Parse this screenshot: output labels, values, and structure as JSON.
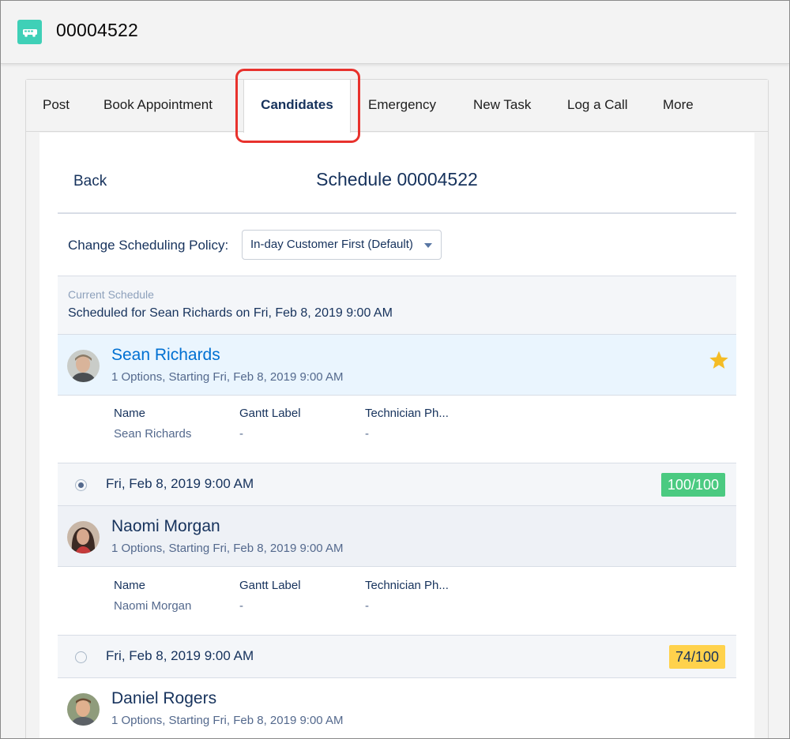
{
  "header": {
    "record_number": "00004522",
    "record_icon": "truck-icon",
    "icon_color": "#3fd0b7"
  },
  "tabs": [
    {
      "label": "Post",
      "active": false
    },
    {
      "label": "Book Appointment",
      "active": false
    },
    {
      "label": "Candidates",
      "active": true
    },
    {
      "label": "Emergency",
      "active": false
    },
    {
      "label": "New Task",
      "active": false
    },
    {
      "label": "Log a Call",
      "active": false
    },
    {
      "label": "More",
      "active": false
    }
  ],
  "panel": {
    "back_label": "Back",
    "title": "Schedule 00004522",
    "policy_label": "Change Scheduling Policy:",
    "policy_value": "In-day Customer First (Default)",
    "current_schedule_label": "Current Schedule",
    "current_schedule_value": "Scheduled for Sean Richards on Fri, Feb 8, 2019 9:00 AM"
  },
  "details_headers": {
    "name": "Name",
    "gantt": "Gantt Label",
    "phone": "Technician Ph..."
  },
  "candidates": [
    {
      "name": "Sean Richards",
      "options": "1 Options, Starting Fri, Feb 8, 2019 9:00 AM",
      "favorite": true,
      "detail_name": "Sean Richards",
      "detail_gantt": "-",
      "detail_phone": "-",
      "slot": "Fri, Feb 8, 2019 9:00 AM",
      "slot_selected": true,
      "grade": "100/100",
      "grade_color": "#4bca81"
    },
    {
      "name": "Naomi Morgan",
      "options": "1 Options, Starting Fri, Feb 8, 2019 9:00 AM",
      "favorite": false,
      "detail_name": "Naomi Morgan",
      "detail_gantt": "-",
      "detail_phone": "-",
      "slot": "Fri, Feb 8, 2019 9:00 AM",
      "slot_selected": false,
      "grade": "74/100",
      "grade_color": "#ffd24c"
    },
    {
      "name": "Daniel Rogers",
      "options": "1 Options, Starting Fri, Feb 8, 2019 9:00 AM",
      "favorite": false
    }
  ],
  "colors": {
    "accent_red": "#e8322d",
    "link_blue": "#0070d2",
    "text_navy": "#16325c",
    "selected_bg": "#eaf5fe",
    "star_gold": "#f4bc25"
  }
}
